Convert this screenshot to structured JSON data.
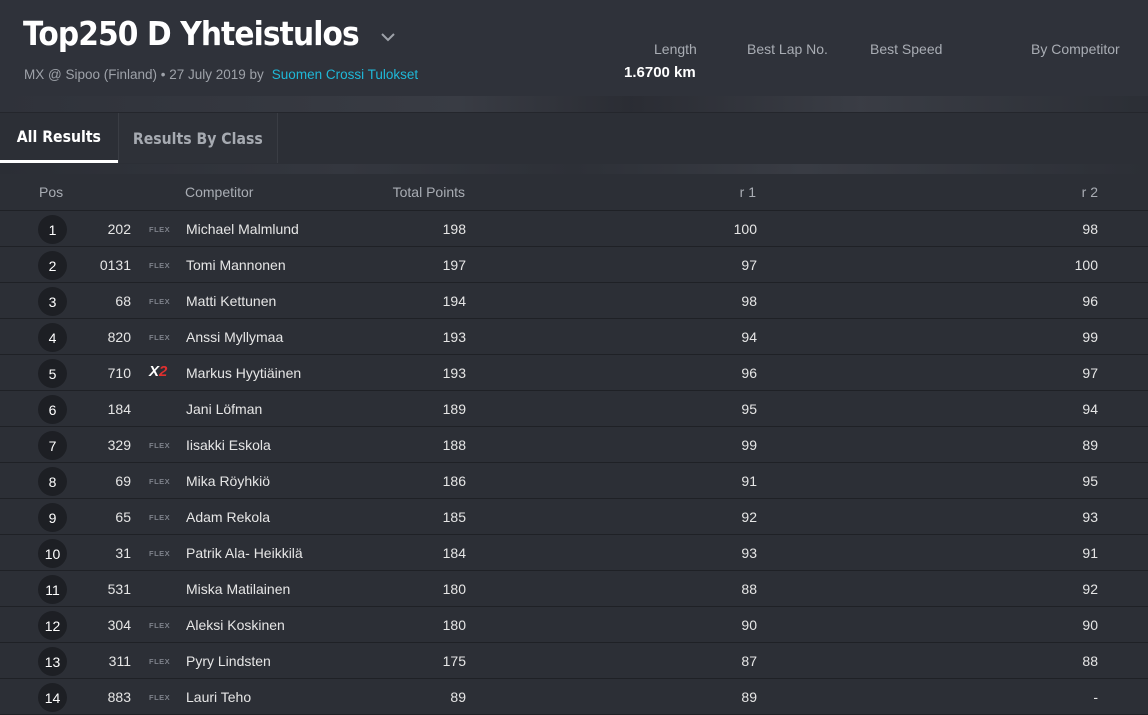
{
  "header": {
    "title": "Top250 D Yhteistulos",
    "subtitle": "MX @ Sipoo (Finland) • 27 July 2019 by",
    "organizer_link": "Suomen Crossi Tulokset",
    "stats": {
      "length_label": "Length",
      "length_value": "1.6700 km",
      "best_lap_label": "Best Lap No.",
      "best_speed_label": "Best Speed",
      "by_competitor_label": "By Competitor"
    }
  },
  "tabs": [
    {
      "label": "All Results",
      "active": true
    },
    {
      "label": "Results By Class",
      "active": false
    }
  ],
  "table": {
    "columns": {
      "pos": "Pos",
      "competitor": "Competitor",
      "total_points": "Total Points",
      "r1": "r 1",
      "r2": "r 2"
    },
    "rows": [
      {
        "pos": "1",
        "number": "202",
        "tag": "FLEX",
        "name": "Michael Malmlund",
        "total": "198",
        "r1": "100",
        "r2": "98"
      },
      {
        "pos": "2",
        "number": "0131",
        "tag": "FLEX",
        "name": "Tomi Mannonen",
        "total": "197",
        "r1": "97",
        "r2": "100"
      },
      {
        "pos": "3",
        "number": "68",
        "tag": "FLEX",
        "name": "Matti Kettunen",
        "total": "194",
        "r1": "98",
        "r2": "96"
      },
      {
        "pos": "4",
        "number": "820",
        "tag": "FLEX",
        "name": "Anssi Myllymaa",
        "total": "193",
        "r1": "94",
        "r2": "99"
      },
      {
        "pos": "5",
        "number": "710",
        "tag": "X2",
        "name": "Markus Hyytiäinen",
        "total": "193",
        "r1": "96",
        "r2": "97"
      },
      {
        "pos": "6",
        "number": "184",
        "tag": "",
        "name": "Jani Löfman",
        "total": "189",
        "r1": "95",
        "r2": "94"
      },
      {
        "pos": "7",
        "number": "329",
        "tag": "FLEX",
        "name": "Iisakki Eskola",
        "total": "188",
        "r1": "99",
        "r2": "89"
      },
      {
        "pos": "8",
        "number": "69",
        "tag": "FLEX",
        "name": "Mika Röyhkiö",
        "total": "186",
        "r1": "91",
        "r2": "95"
      },
      {
        "pos": "9",
        "number": "65",
        "tag": "FLEX",
        "name": "Adam Rekola",
        "total": "185",
        "r1": "92",
        "r2": "93"
      },
      {
        "pos": "10",
        "number": "31",
        "tag": "FLEX",
        "name": "Patrik Ala- Heikkilä",
        "total": "184",
        "r1": "93",
        "r2": "91"
      },
      {
        "pos": "11",
        "number": "531",
        "tag": "",
        "name": "Miska Matilainen",
        "total": "180",
        "r1": "88",
        "r2": "92"
      },
      {
        "pos": "12",
        "number": "304",
        "tag": "FLEX",
        "name": "Aleksi Koskinen",
        "total": "180",
        "r1": "90",
        "r2": "90"
      },
      {
        "pos": "13",
        "number": "311",
        "tag": "FLEX",
        "name": "Pyry Lindsten",
        "total": "175",
        "r1": "87",
        "r2": "88"
      },
      {
        "pos": "14",
        "number": "883",
        "tag": "FLEX",
        "name": "Lauri Teho",
        "total": "89",
        "r1": "89",
        "r2": "-"
      }
    ]
  },
  "colors": {
    "background": "#2c2f36",
    "accent_link": "#1fb8d8",
    "x2_red": "#e0302f"
  }
}
